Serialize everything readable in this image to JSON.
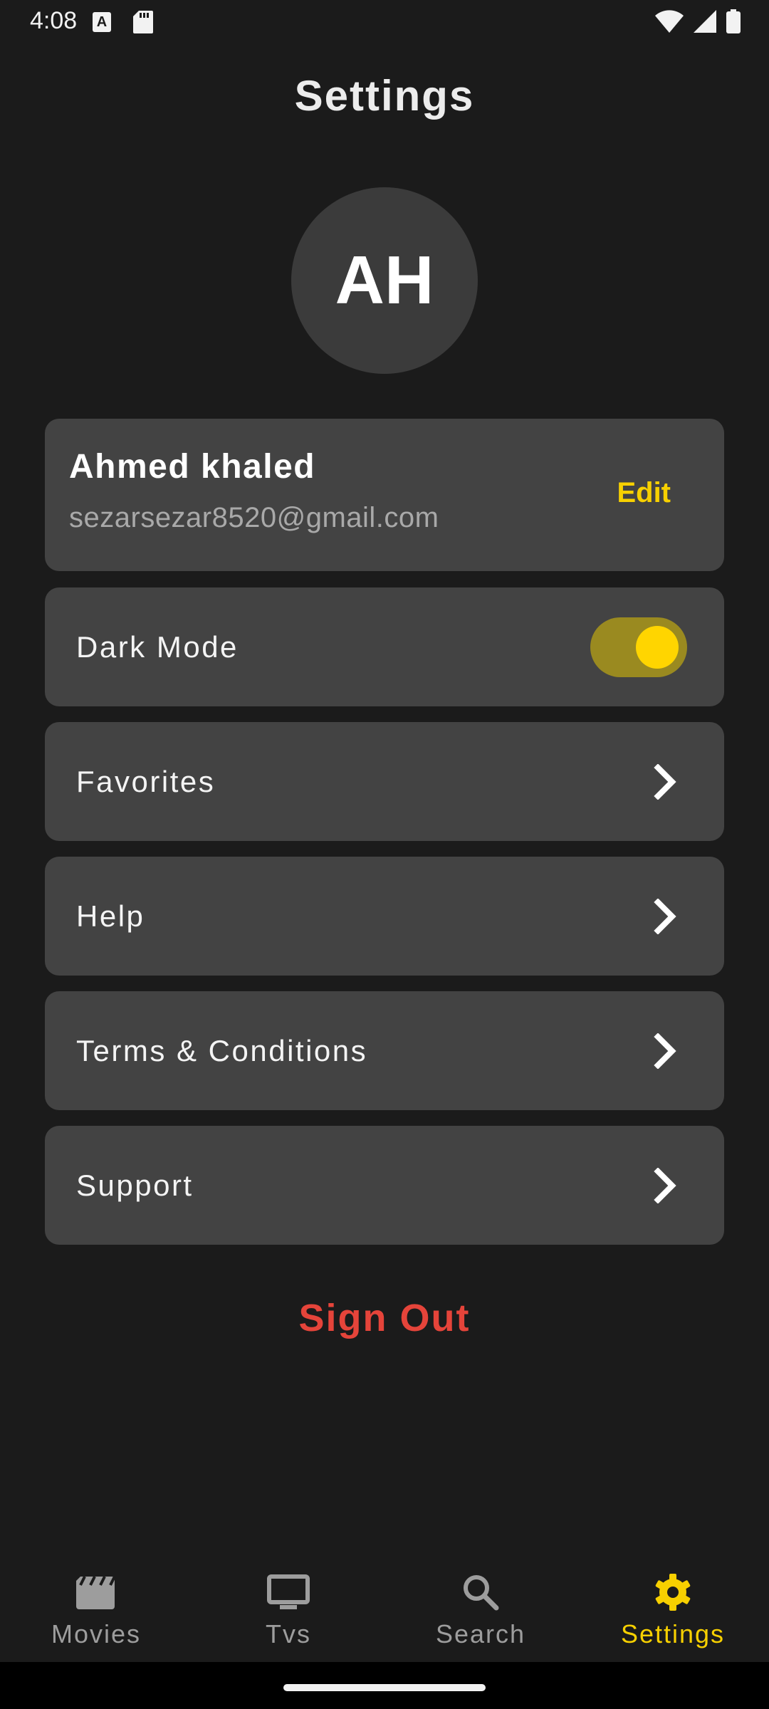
{
  "status_bar": {
    "time": "4:08",
    "icons": [
      "a-notification-icon",
      "sd-card-icon",
      "wifi-icon",
      "signal-icon",
      "battery-icon"
    ]
  },
  "title": "Settings",
  "avatar": {
    "initials": "AH"
  },
  "profile": {
    "name": "Ahmed khaled",
    "email": "sezarsezar8520@gmail.com",
    "edit_label": "Edit"
  },
  "settings": {
    "dark_mode": {
      "label": "Dark Mode",
      "enabled": true
    },
    "favorites": {
      "label": "Favorites",
      "icon": "chevron-right-icon"
    },
    "help": {
      "label": "Help",
      "icon": "chevron-right-icon"
    },
    "terms": {
      "label": "Terms & Conditions",
      "icon": "chevron-right-icon"
    },
    "support": {
      "label": "Support",
      "icon": "chevron-right-icon"
    }
  },
  "sign_out": "Sign Out",
  "bottom_nav": {
    "items": [
      {
        "label": "Movies",
        "icon": "clapperboard-icon",
        "active": false
      },
      {
        "label": "Tvs",
        "icon": "tv-icon",
        "active": false
      },
      {
        "label": "Search",
        "icon": "search-icon",
        "active": false
      },
      {
        "label": "Settings",
        "icon": "gear-icon",
        "active": true
      }
    ]
  },
  "colors": {
    "background": "#1b1b1b",
    "card": "#434343",
    "accent": "#f7d000",
    "danger": "#e5443a",
    "inactive": "#9d9d9d"
  }
}
